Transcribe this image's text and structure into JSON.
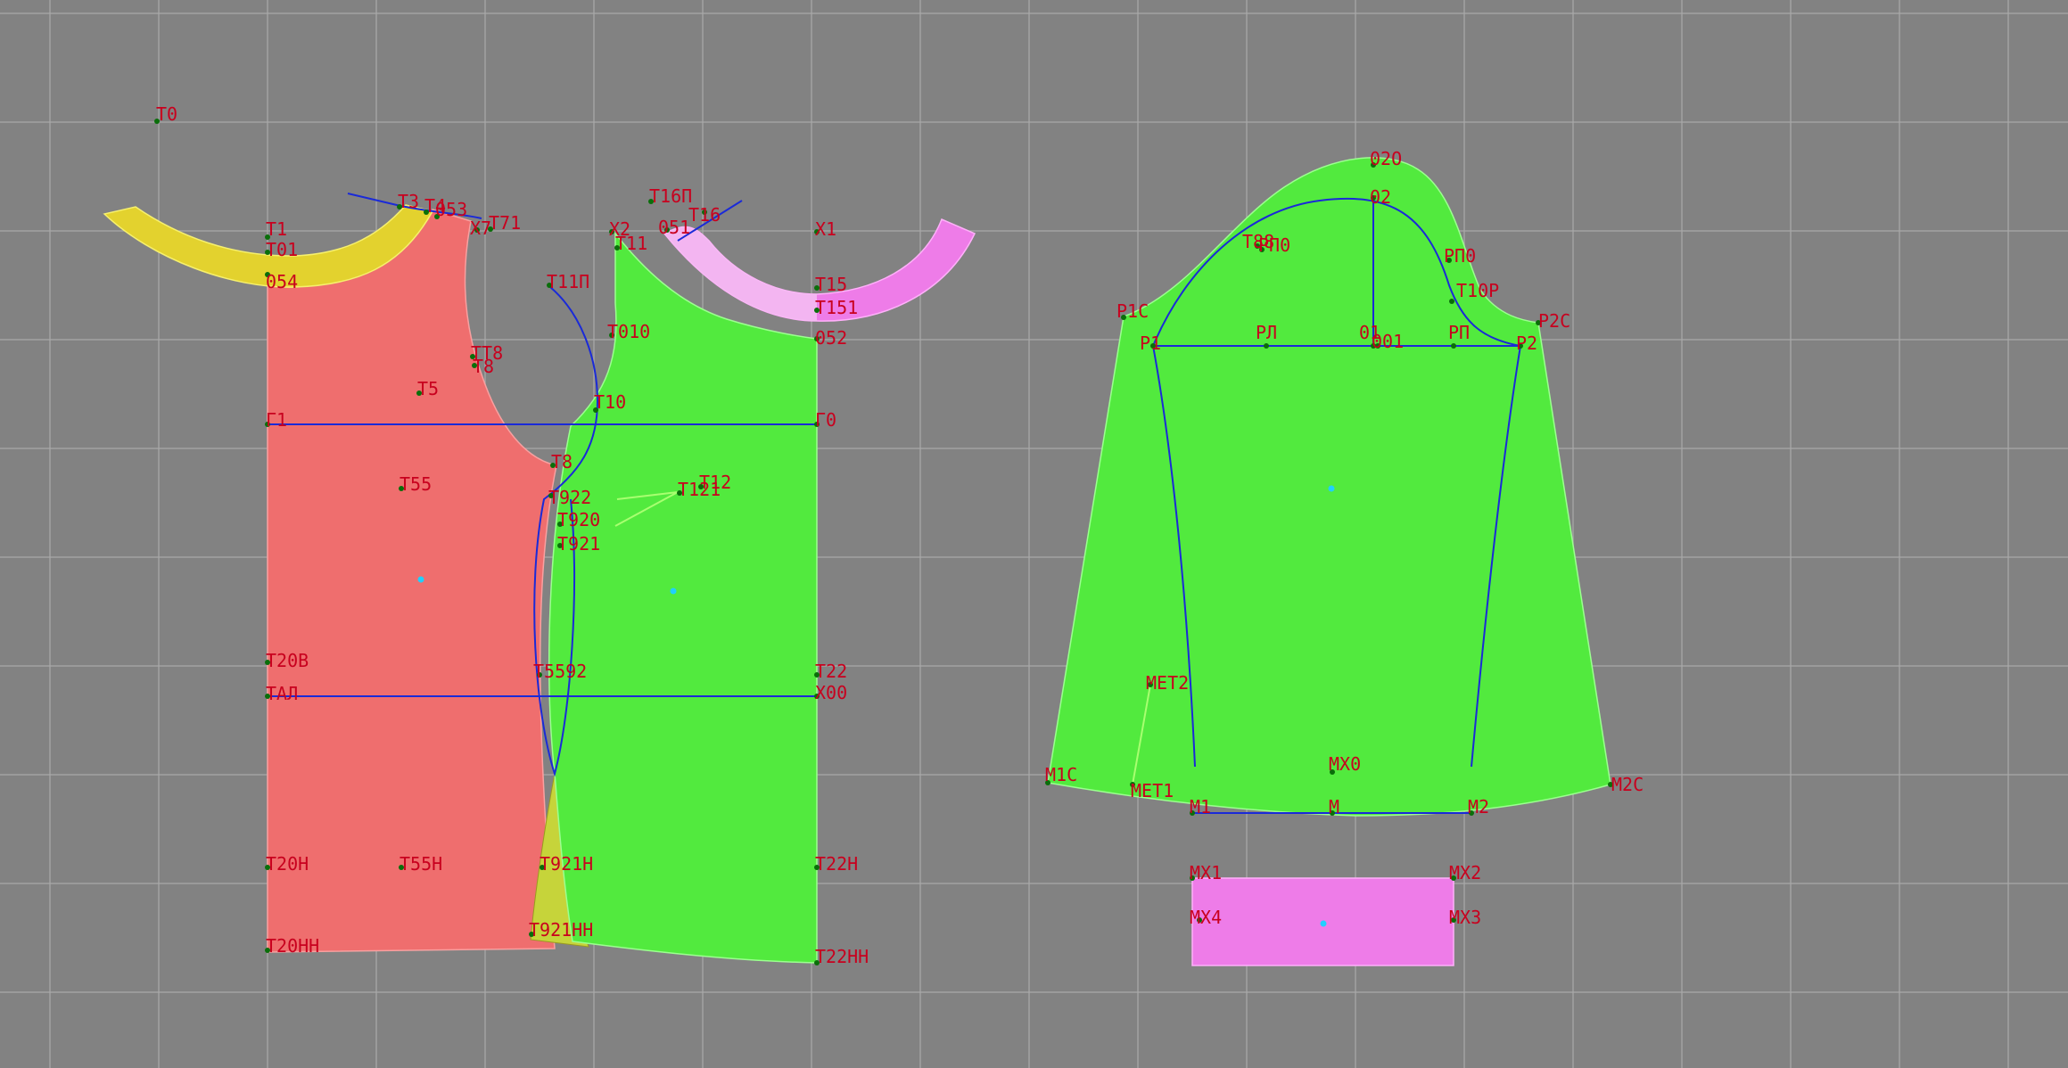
{
  "colors": {
    "background": "#828282",
    "grid": "#a8a8a8",
    "piece_red": "#ef6e6e",
    "piece_green": "#52ea3e",
    "piece_yellow": "#e3d22e",
    "piece_pink": "#ee7ce8",
    "piece_olive": "#c6d43a",
    "label": "#c8001e",
    "construction": "#1a2ad8"
  },
  "labels": {
    "t0": "T0",
    "t1": "T1",
    "t01": "T01",
    "o54": "054",
    "t3": "T3",
    "t4": "T4",
    "o53": "053",
    "t71": "T71",
    "x7": "X7",
    "t11p": "T11П",
    "tt8": "TT8",
    "t8": "T8",
    "t5": "T5",
    "g1": "Г1",
    "t55": "T55",
    "t20v": "T20В",
    "tal": "TАЛ",
    "t20n": "T20Н",
    "t20hh": "T20НН",
    "t55n": "T55Н",
    "t8b": "T8",
    "t10": "T10",
    "t922": "T922",
    "t920": "T920",
    "t921": "T921",
    "t121": "T121",
    "t12": "T12",
    "t592": "T5592",
    "t921h": "T921Н",
    "t921hh": "T921НН",
    "x2": "X2",
    "t11": "T11",
    "t16p": "T16П",
    "o51": "051",
    "t16": "T16",
    "x1": "X1",
    "t15": "T15",
    "t151": "T151",
    "o52": "052",
    "t010": "T010",
    "g0": "Г0",
    "t22": "T22",
    "x00": "X00",
    "t22n": "T22Н",
    "t22hh": "T22НН",
    "o2o": "02О",
    "o2": "02",
    "t88": "T88",
    "rp0a": "РП0",
    "rp0b": "РП0",
    "t10p": "T10Р",
    "r1c": "Р1С",
    "r2c": "Р2С",
    "r1": "Р1",
    "rl": "РЛ",
    "o1": "01",
    "o01": "001",
    "rp": "РП",
    "r2": "Р2",
    "met2": "МЕТ2",
    "mx0": "МХ0",
    "m1c": "М1С",
    "met1": "МЕТ1",
    "m1": "М1",
    "m": "М",
    "m2": "М2",
    "m2c": "М2С",
    "mx1": "МХ1",
    "mx2": "МХ2",
    "mx4": "МХ4",
    "mx3": "МХ3"
  }
}
